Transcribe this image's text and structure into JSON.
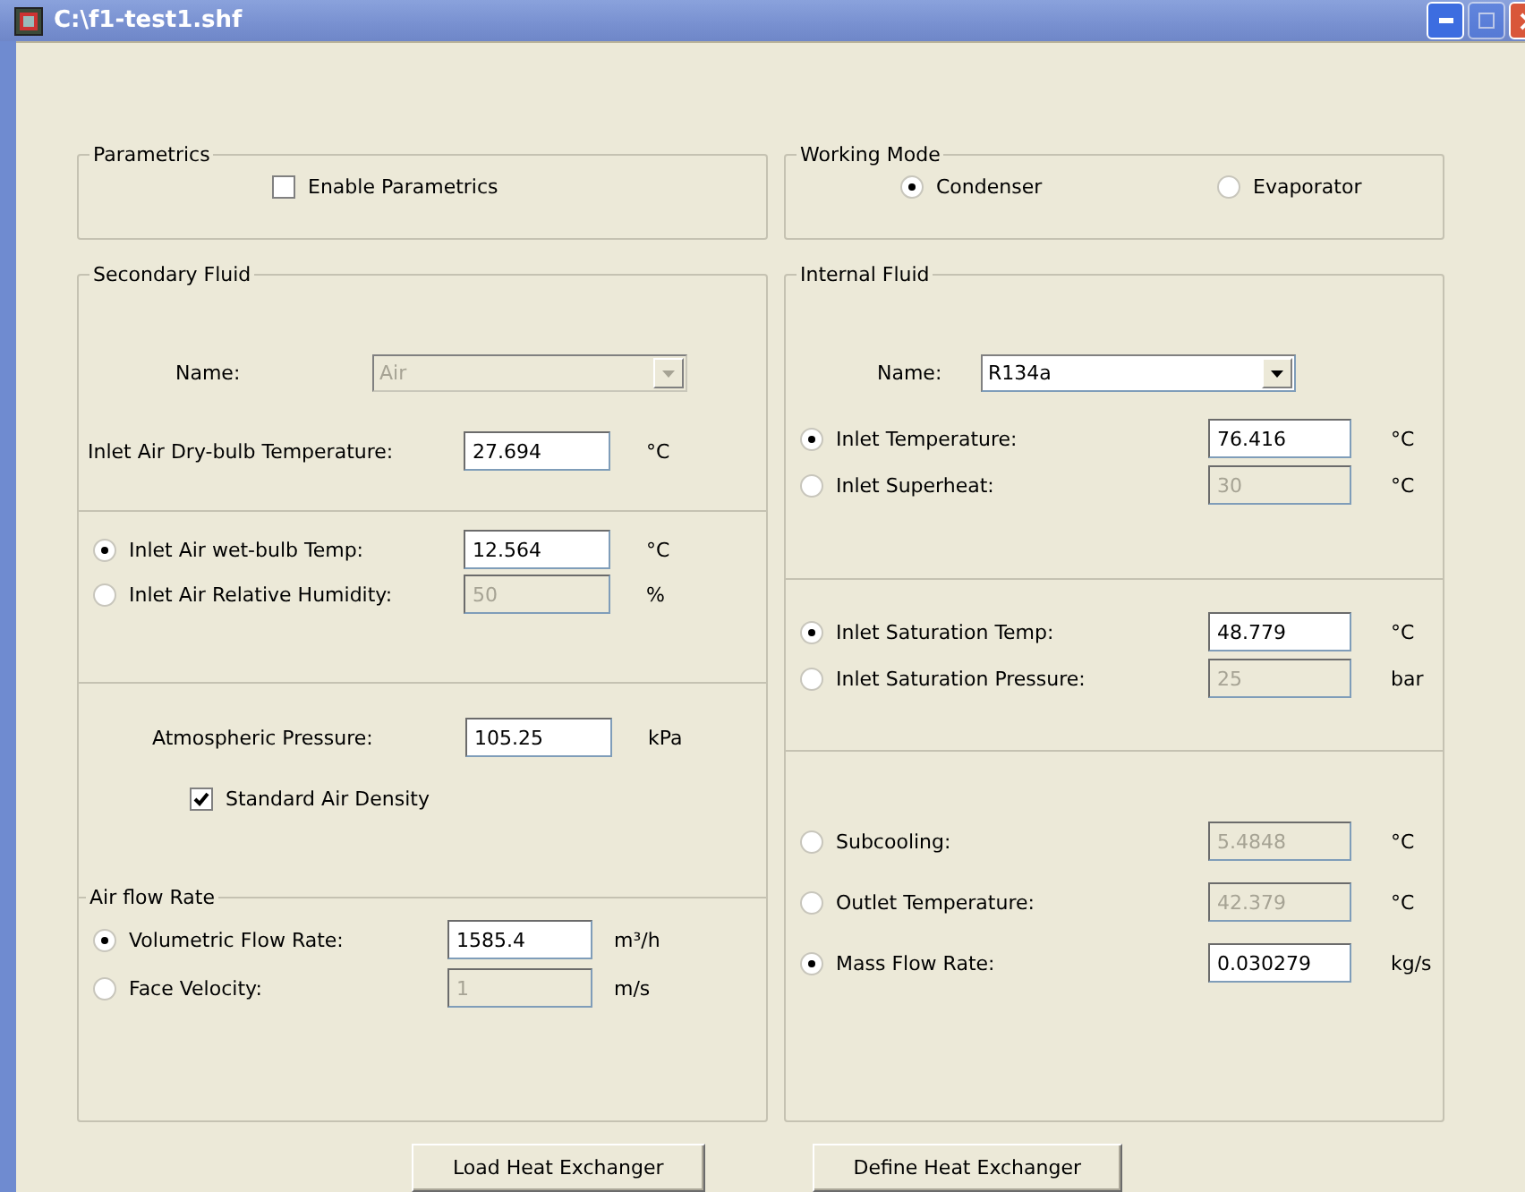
{
  "window": {
    "title": "C:\\f1-test1.shf"
  },
  "parametrics": {
    "legend": "Parametrics",
    "checkbox": {
      "label": "Enable Parametrics",
      "checked": false
    }
  },
  "working_mode": {
    "legend": "Working Mode",
    "options": [
      {
        "label": "Condenser",
        "selected": true
      },
      {
        "label": "Evaporator",
        "selected": false
      }
    ]
  },
  "secondary_fluid": {
    "legend": "Secondary Fluid",
    "name": {
      "label": "Name:",
      "value": "Air",
      "disabled": true
    },
    "dry_bulb": {
      "label": "Inlet Air Dry-bulb Temperature:",
      "value": "27.694",
      "unit": "°C"
    },
    "humidity_options": [
      {
        "label": "Inlet Air wet-bulb Temp:",
        "value": "12.564",
        "unit": "°C",
        "selected": true
      },
      {
        "label": "Inlet Air Relative Humidity:",
        "value": "50",
        "unit": "%",
        "selected": false
      }
    ],
    "pressure": {
      "label": "Atmospheric Pressure:",
      "value": "105.25",
      "unit": "kPa"
    },
    "standard_density": {
      "label": "Standard Air Density",
      "checked": true
    },
    "air_flow": {
      "legend": "Air flow Rate",
      "options": [
        {
          "label": "Volumetric Flow Rate:",
          "value": "1585.4",
          "unit": "m³/h",
          "selected": true
        },
        {
          "label": "Face Velocity:",
          "value": "1",
          "unit": "m/s",
          "selected": false
        }
      ]
    }
  },
  "internal_fluid": {
    "legend": "Internal Fluid",
    "name": {
      "label": "Name:",
      "value": "R134a",
      "disabled": false
    },
    "inlet_options": [
      {
        "label": "Inlet Temperature:",
        "value": "76.416",
        "unit": "°C",
        "selected": true
      },
      {
        "label": "Inlet Superheat:",
        "value": "30",
        "unit": "°C",
        "selected": false
      }
    ],
    "saturation_options": [
      {
        "label": "Inlet Saturation Temp:",
        "value": "48.779",
        "unit": "°C",
        "selected": true
      },
      {
        "label": "Inlet Saturation Pressure:",
        "value": "25",
        "unit": "bar",
        "selected": false
      }
    ],
    "outlet_options": [
      {
        "label": "Subcooling:",
        "value": "5.4848",
        "unit": "°C",
        "selected": false
      },
      {
        "label": "Outlet Temperature:",
        "value": "42.379",
        "unit": "°C",
        "selected": false
      },
      {
        "label": "Mass Flow Rate:",
        "value": "0.030279",
        "unit": "kg/s",
        "selected": true
      }
    ]
  },
  "buttons": [
    "Load Heat Exchanger",
    "Define Heat Exchanger"
  ]
}
